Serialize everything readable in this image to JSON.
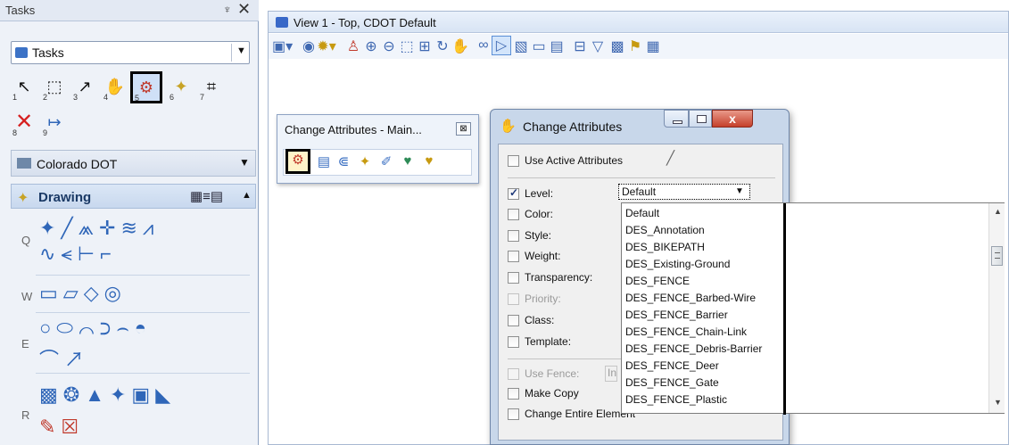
{
  "tasks": {
    "title": "Tasks",
    "pin": "♆",
    "close": "✕",
    "dropdown_label": "Tasks",
    "dropdown_arrow": "▼",
    "tools": [
      {
        "glyph": "↖",
        "num": "1"
      },
      {
        "glyph": "⬚",
        "num": "2"
      },
      {
        "glyph": "↗",
        "num": "3"
      },
      {
        "glyph": "✋",
        "num": "4"
      },
      {
        "glyph": "⚙",
        "num": "5"
      },
      {
        "glyph": "✦",
        "num": "6"
      },
      {
        "glyph": "⌗",
        "num": "7"
      },
      {
        "glyph": "✕",
        "num": "8"
      },
      {
        "glyph": "↦",
        "num": "9"
      }
    ],
    "section_colorado": "Colorado DOT",
    "section_drawing": "Drawing",
    "row_labels": [
      "Q",
      "W",
      "E",
      "R"
    ]
  },
  "view": {
    "title": "View 1 - Top, CDOT Default"
  },
  "toolbox": {
    "title": "Change Attributes - Main...",
    "close": "⊠"
  },
  "dialog": {
    "title": "Change Attributes",
    "close": "x",
    "use_active": "Use Active Attributes",
    "fields": {
      "level": "Level:",
      "color": "Color:",
      "style": "Style:",
      "weight": "Weight:",
      "transparency": "Transparency:",
      "priority": "Priority:",
      "class": "Class:",
      "template": "Template:",
      "use_fence": "Use Fence:",
      "make_copy": "Make Copy",
      "change_entire": "Change Entire Element"
    },
    "level_value": "Default",
    "inside_value": "In"
  },
  "level_list": [
    "Default",
    "DES_Annotation",
    "DES_BIKEPATH",
    "DES_Existing-Ground",
    "DES_FENCE",
    "DES_FENCE_Barbed-Wire",
    "DES_FENCE_Barrier",
    "DES_FENCE_Chain-Link",
    "DES_FENCE_Debris-Barrier",
    "DES_FENCE_Deer",
    "DES_FENCE_Gate",
    "DES_FENCE_Plastic"
  ]
}
